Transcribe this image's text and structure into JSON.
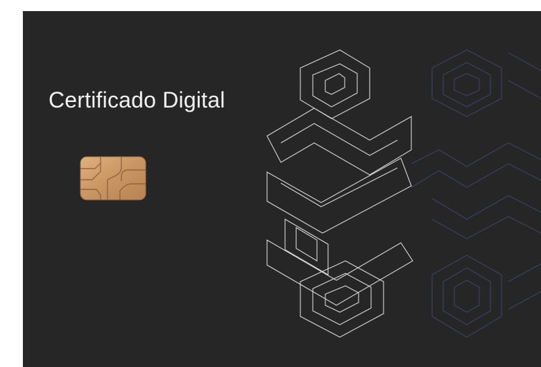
{
  "card": {
    "title": "Certificado Digital",
    "background_color": "#262626",
    "chip_icon": "smart-card-chip-icon",
    "emblem_icon": "hexagonal-geometric-emblem",
    "emblem_colors": {
      "light": "#d9d9d9",
      "dark": "#3a4466"
    }
  }
}
